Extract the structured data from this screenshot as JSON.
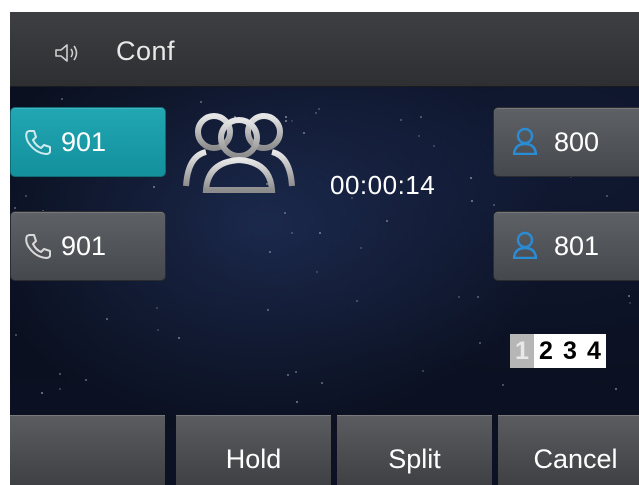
{
  "title_bar": {
    "title": "Conf",
    "icon": "speaker-icon"
  },
  "line_keys_left": [
    {
      "label": "901",
      "icon": "handset-icon",
      "active": true
    },
    {
      "label": "901",
      "icon": "handset-icon",
      "active": false
    }
  ],
  "conference": {
    "icon": "conference-icon",
    "duration": "00:00:14"
  },
  "participants": [
    {
      "label": "800",
      "icon": "contact-icon"
    },
    {
      "label": "801",
      "icon": "contact-icon"
    }
  ],
  "pages": {
    "items": [
      "1",
      "2",
      "3",
      "4"
    ],
    "current": "1"
  },
  "softkeys": [
    {
      "label": ""
    },
    {
      "label": "Hold"
    },
    {
      "label": "Split"
    },
    {
      "label": "Cancel"
    }
  ],
  "colors": {
    "accent_active": "#13909c",
    "contact_icon": "#2b8cd6",
    "background": "#0a0f1e"
  }
}
